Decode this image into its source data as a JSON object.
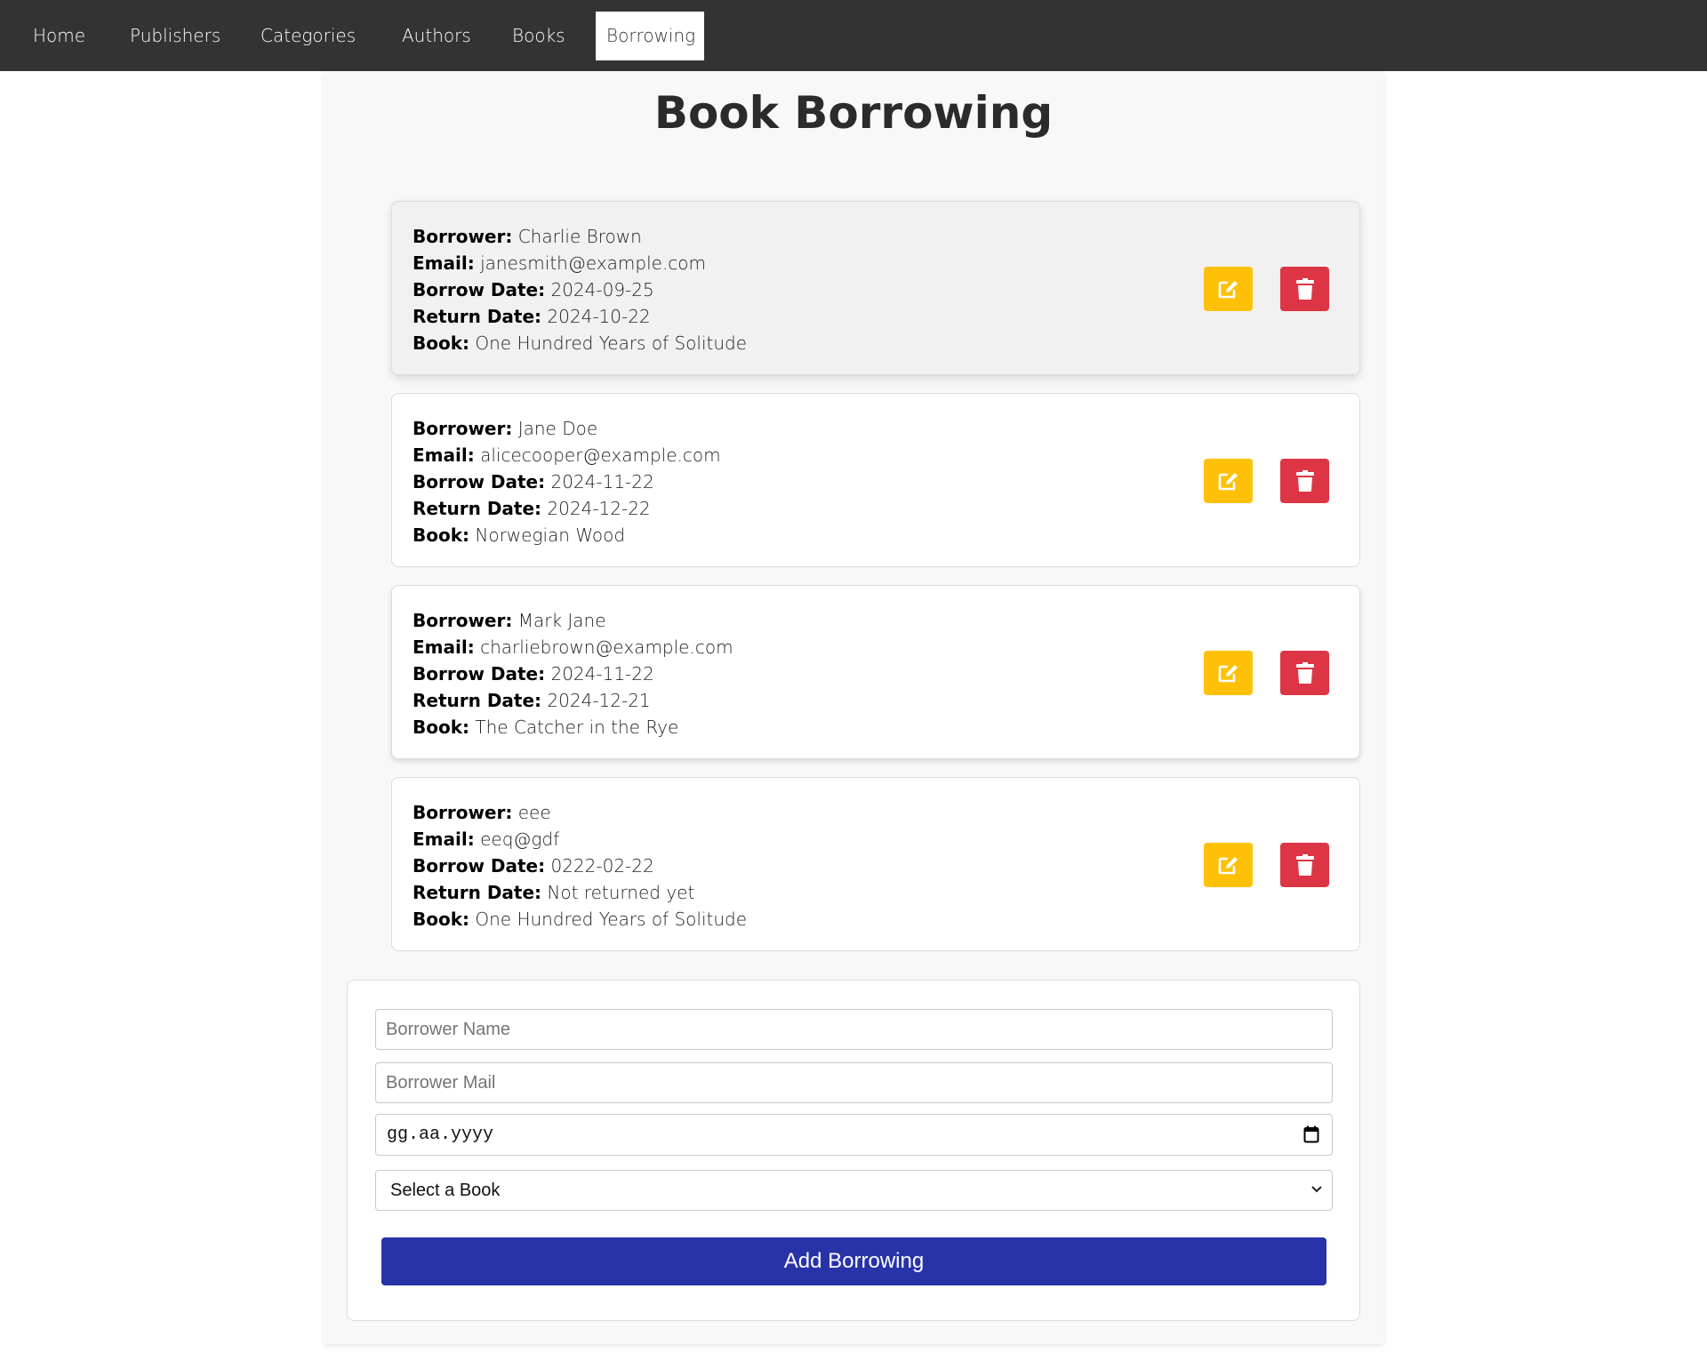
{
  "nav": {
    "items": [
      {
        "label": "Home",
        "name": "nav-item-home"
      },
      {
        "label": "Publishers",
        "name": "nav-item-publishers"
      },
      {
        "label": "Categories",
        "name": "nav-item-categories"
      },
      {
        "label": "Authors",
        "name": "nav-item-authors"
      },
      {
        "label": "Books",
        "name": "nav-item-books"
      },
      {
        "label": "Borrowing",
        "name": "nav-item-borrowing",
        "active": true
      }
    ]
  },
  "page": {
    "title": "Book Borrowing"
  },
  "labels": {
    "borrower": "Borrower:",
    "email": "Email:",
    "borrow_date": "Borrow Date:",
    "return_date": "Return Date:",
    "book": "Book:"
  },
  "borrowings": [
    {
      "borrower": "Charlie Brown",
      "email": "janesmith@example.com",
      "borrow_date": "2024-09-25",
      "return_date": "2024-10-22",
      "book": "One Hundred Years of Solitude"
    },
    {
      "borrower": "Jane Doe",
      "email": "alicecooper@example.com",
      "borrow_date": "2024-11-22",
      "return_date": "2024-12-22",
      "book": "Norwegian Wood"
    },
    {
      "borrower": "Mark Jane",
      "email": "charliebrown@example.com",
      "borrow_date": "2024-11-22",
      "return_date": "2024-12-21",
      "book": "The Catcher in the Rye"
    },
    {
      "borrower": "eee",
      "email": "eeq@gdf",
      "borrow_date": "0222-02-22",
      "return_date": "Not returned yet",
      "book": "One Hundred Years of Solitude"
    }
  ],
  "form": {
    "borrower_name_placeholder": "Borrower Name",
    "borrower_mail_placeholder": "Borrower Mail",
    "date_value": "gg.aa.yyyy",
    "book_select_value": "Select a Book",
    "submit_label": "Add Borrowing"
  },
  "colors": {
    "nav_bg": "#333333",
    "edit": "#ffc107",
    "delete": "#dc3545",
    "submit": "#2833a8"
  },
  "icons": {
    "edit": "edit-icon",
    "delete": "trash-icon",
    "date": "calendar-icon",
    "select": "chevron-down-icon"
  }
}
